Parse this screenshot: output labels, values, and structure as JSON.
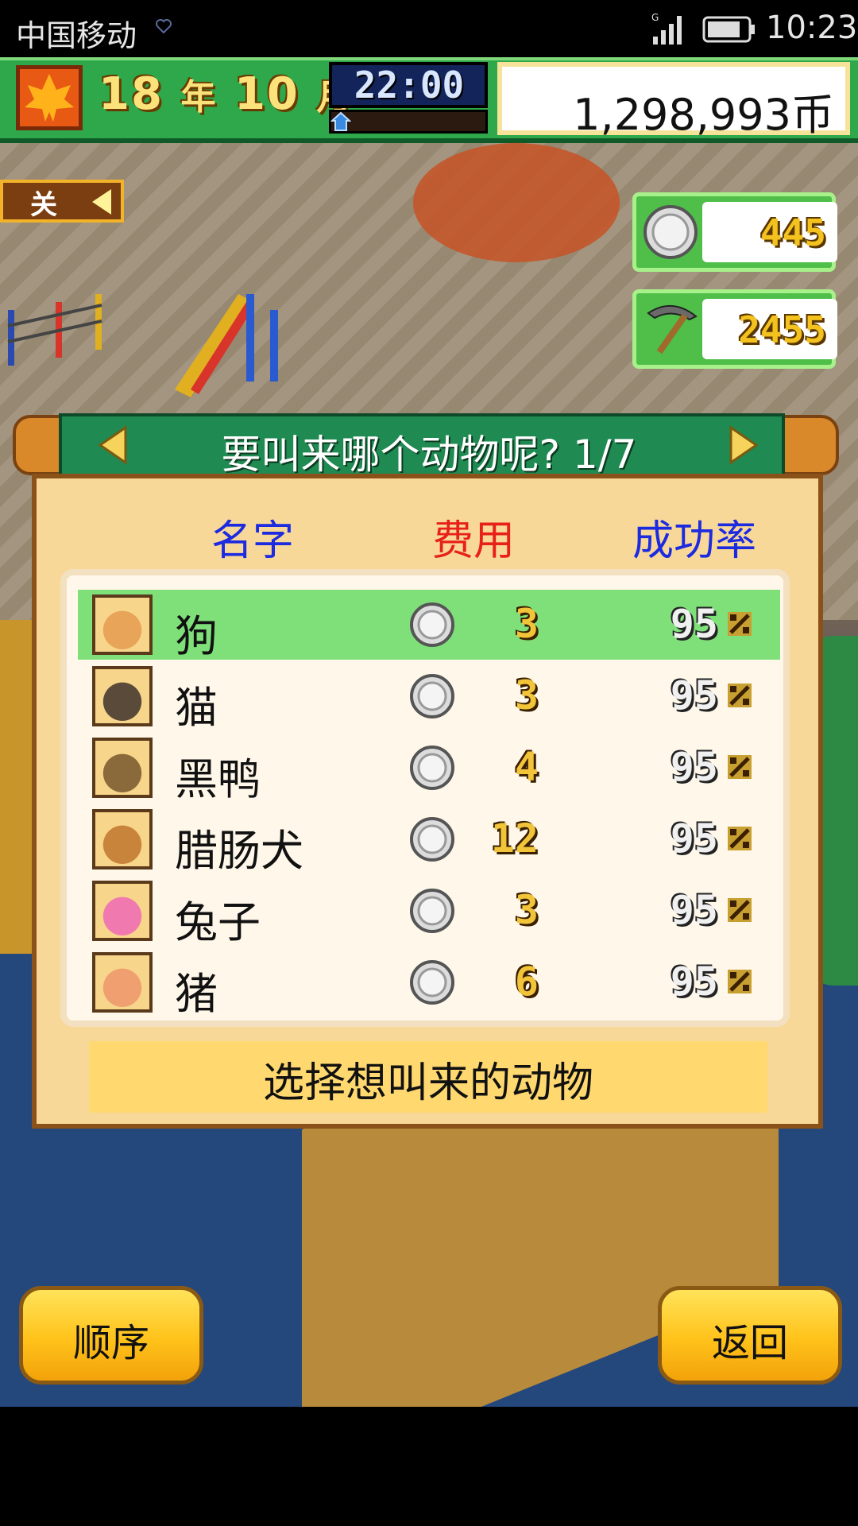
{
  "status_bar": {
    "carrier": "中国移动",
    "time": "10:23",
    "network": "G"
  },
  "hud": {
    "year": "18",
    "year_unit": "年",
    "month": "10",
    "month_unit": "月",
    "game_time": "22:00",
    "money": "1,298,993币"
  },
  "scene": {
    "sign_label": "关",
    "medals": "445",
    "research_points": "2455"
  },
  "dialog": {
    "title": "要叫来哪个动物呢?  1/7",
    "columns": {
      "name": "名字",
      "cost": "费用",
      "rate": "成功率"
    },
    "animals": [
      {
        "name": "狗",
        "cost": "3",
        "rate": "95",
        "selected": true,
        "color": "#e8a458"
      },
      {
        "name": "猫",
        "cost": "3",
        "rate": "95",
        "selected": false,
        "color": "#5a4a3a"
      },
      {
        "name": "黑鸭",
        "cost": "4",
        "rate": "95",
        "selected": false,
        "color": "#8a6a3a"
      },
      {
        "name": "腊肠犬",
        "cost": "12",
        "rate": "95",
        "selected": false,
        "color": "#c8843a"
      },
      {
        "name": "兔子",
        "cost": "3",
        "rate": "95",
        "selected": false,
        "color": "#f07ab0"
      },
      {
        "name": "猪",
        "cost": "6",
        "rate": "95",
        "selected": false,
        "color": "#f0a070"
      }
    ],
    "hint": "选择想叫来的动物"
  },
  "buttons": {
    "order": "顺序",
    "back": "返回"
  },
  "colors": {
    "hud_green": "#2ea84a",
    "header_green": "#1f8a52",
    "selected_row": "#7fe07a",
    "name_header": "#1d2be0",
    "cost_header": "#e8201a",
    "button_yellow": "#ffc21a"
  }
}
